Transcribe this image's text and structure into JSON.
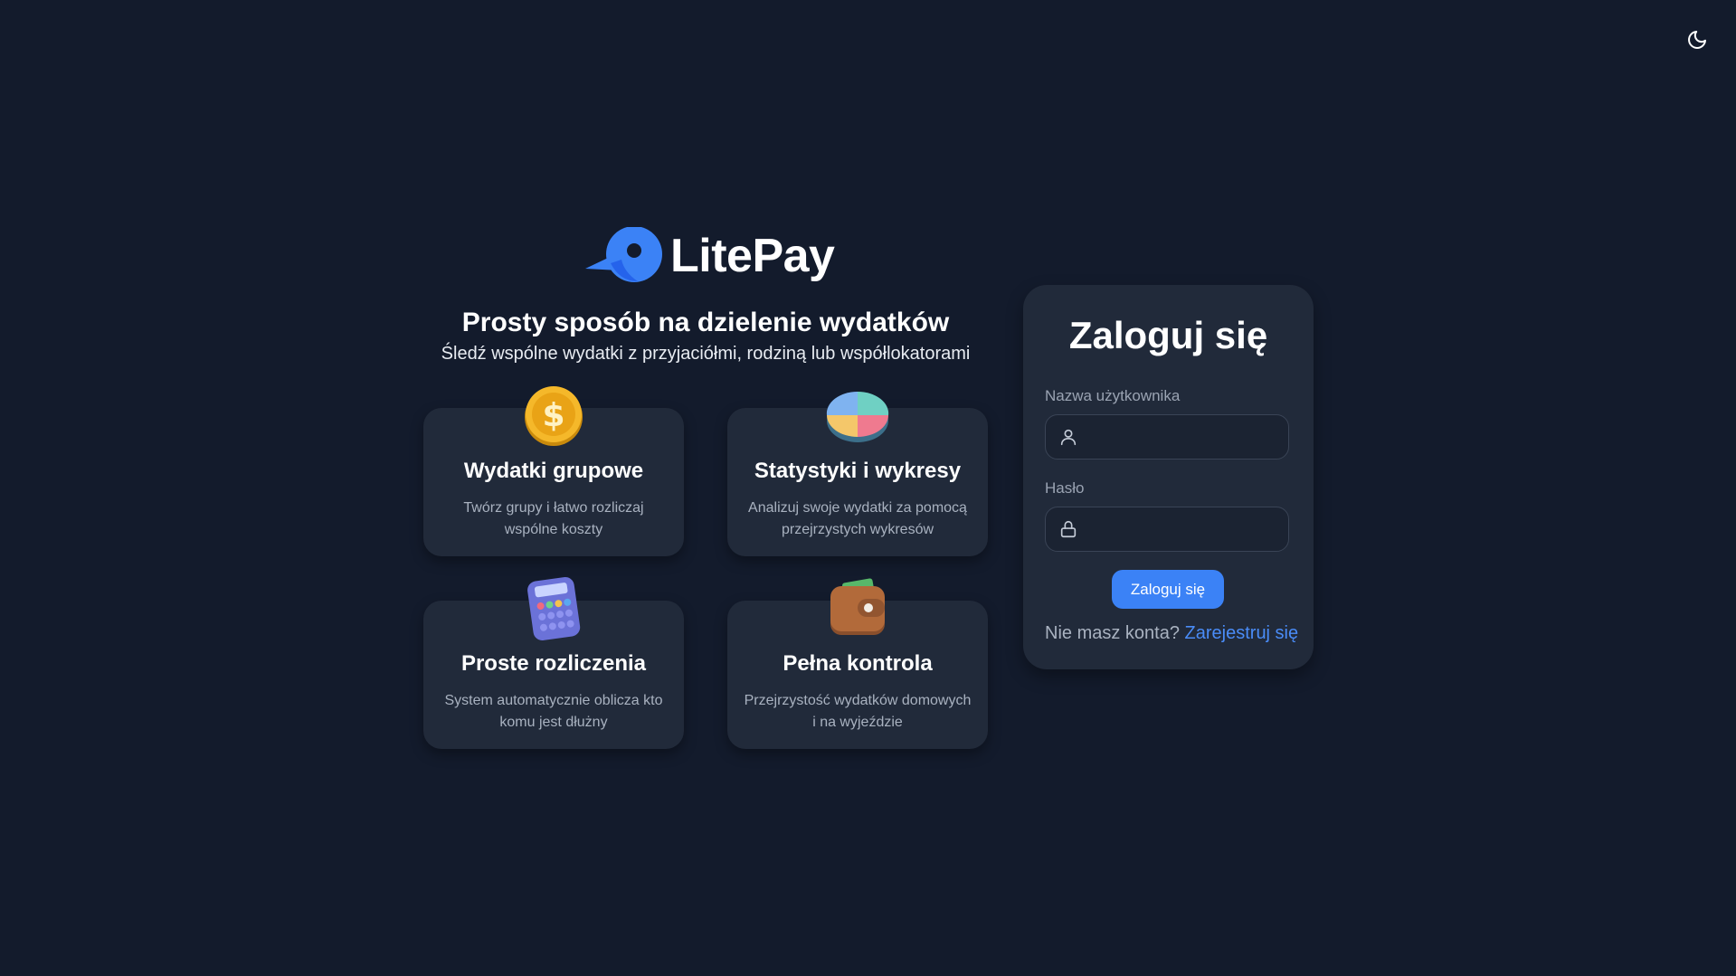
{
  "brand": {
    "name": "LitePay",
    "logo_icon": "bird-logo-icon"
  },
  "theme_toggle": {
    "icon": "moon-icon"
  },
  "hero": {
    "title": "Prosty sposób na dzielenie wydatków",
    "subtitle": "Śledź wspólne wydatki z przyjaciółmi, rodziną lub współlokatorami"
  },
  "features": [
    {
      "icon": "gold-coin-dollar-icon",
      "title": "Wydatki grupowe",
      "description": "Twórz grupy i łatwo rozliczaj wspólne koszty"
    },
    {
      "icon": "pie-chart-icon",
      "title": "Statystyki i wykresy",
      "description": "Analizuj swoje wydatki za pomocą przejrzystych wykresów"
    },
    {
      "icon": "calculator-icon",
      "title": "Proste rozliczenia",
      "description": "System automatycznie oblicza kto komu jest dłużny"
    },
    {
      "icon": "wallet-icon",
      "title": "Pełna kontrola",
      "description": "Przejrzystość wydatków domowych i na wyjeździe"
    }
  ],
  "login": {
    "title": "Zaloguj się",
    "username_label": "Nazwa użytkownika",
    "username_value": "",
    "username_icon": "user-icon",
    "password_label": "Hasło",
    "password_value": "",
    "password_icon": "lock-icon",
    "submit_label": "Zaloguj się",
    "no_account_text": "Nie masz konta?",
    "register_link": "Zarejestruj się"
  },
  "colors": {
    "background": "#131b2c",
    "card": "#212a3a",
    "accent": "#3b82f6",
    "link": "#4a8cf7",
    "muted_text": "#a9b2c0"
  }
}
